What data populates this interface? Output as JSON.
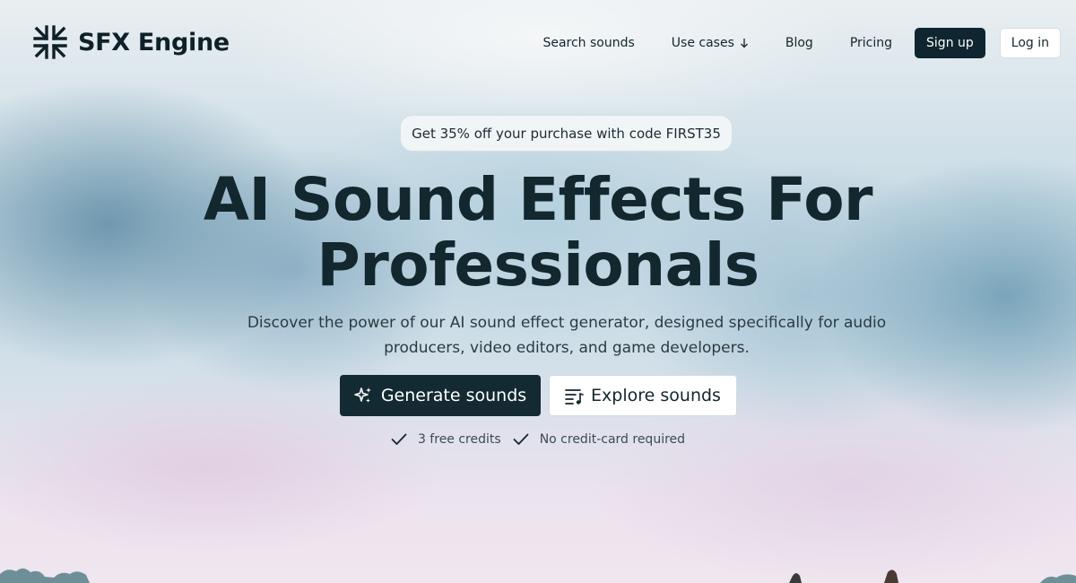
{
  "brand": {
    "name": "SFX Engine",
    "logo_icon": "asterisk-arrows-icon"
  },
  "nav": {
    "items": [
      {
        "label": "Search sounds"
      },
      {
        "label": "Use cases",
        "icon": "arrow-down-icon"
      },
      {
        "label": "Blog"
      },
      {
        "label": "Pricing"
      }
    ],
    "signup_label": "Sign up",
    "login_label": "Log in"
  },
  "promo": {
    "text": "Get 35% off your purchase with code FIRST35"
  },
  "hero": {
    "title_line1": "AI Sound Effects For",
    "title_line2": "Professionals",
    "subtitle_line1": "Discover the power of our AI sound effect generator, designed specifically for audio",
    "subtitle_line2": "producers, video editors, and game developers."
  },
  "cta": {
    "generate_label": "Generate sounds",
    "generate_icon": "sparkles-icon",
    "explore_label": "Explore sounds",
    "explore_icon": "music-list-icon"
  },
  "perks": [
    {
      "label": "3 free credits",
      "icon": "check-icon"
    },
    {
      "label": "No credit-card required",
      "icon": "check-icon"
    }
  ],
  "colors": {
    "primary_dark": "#132a33",
    "text": "#12272e",
    "background": "#cfdfe8"
  }
}
